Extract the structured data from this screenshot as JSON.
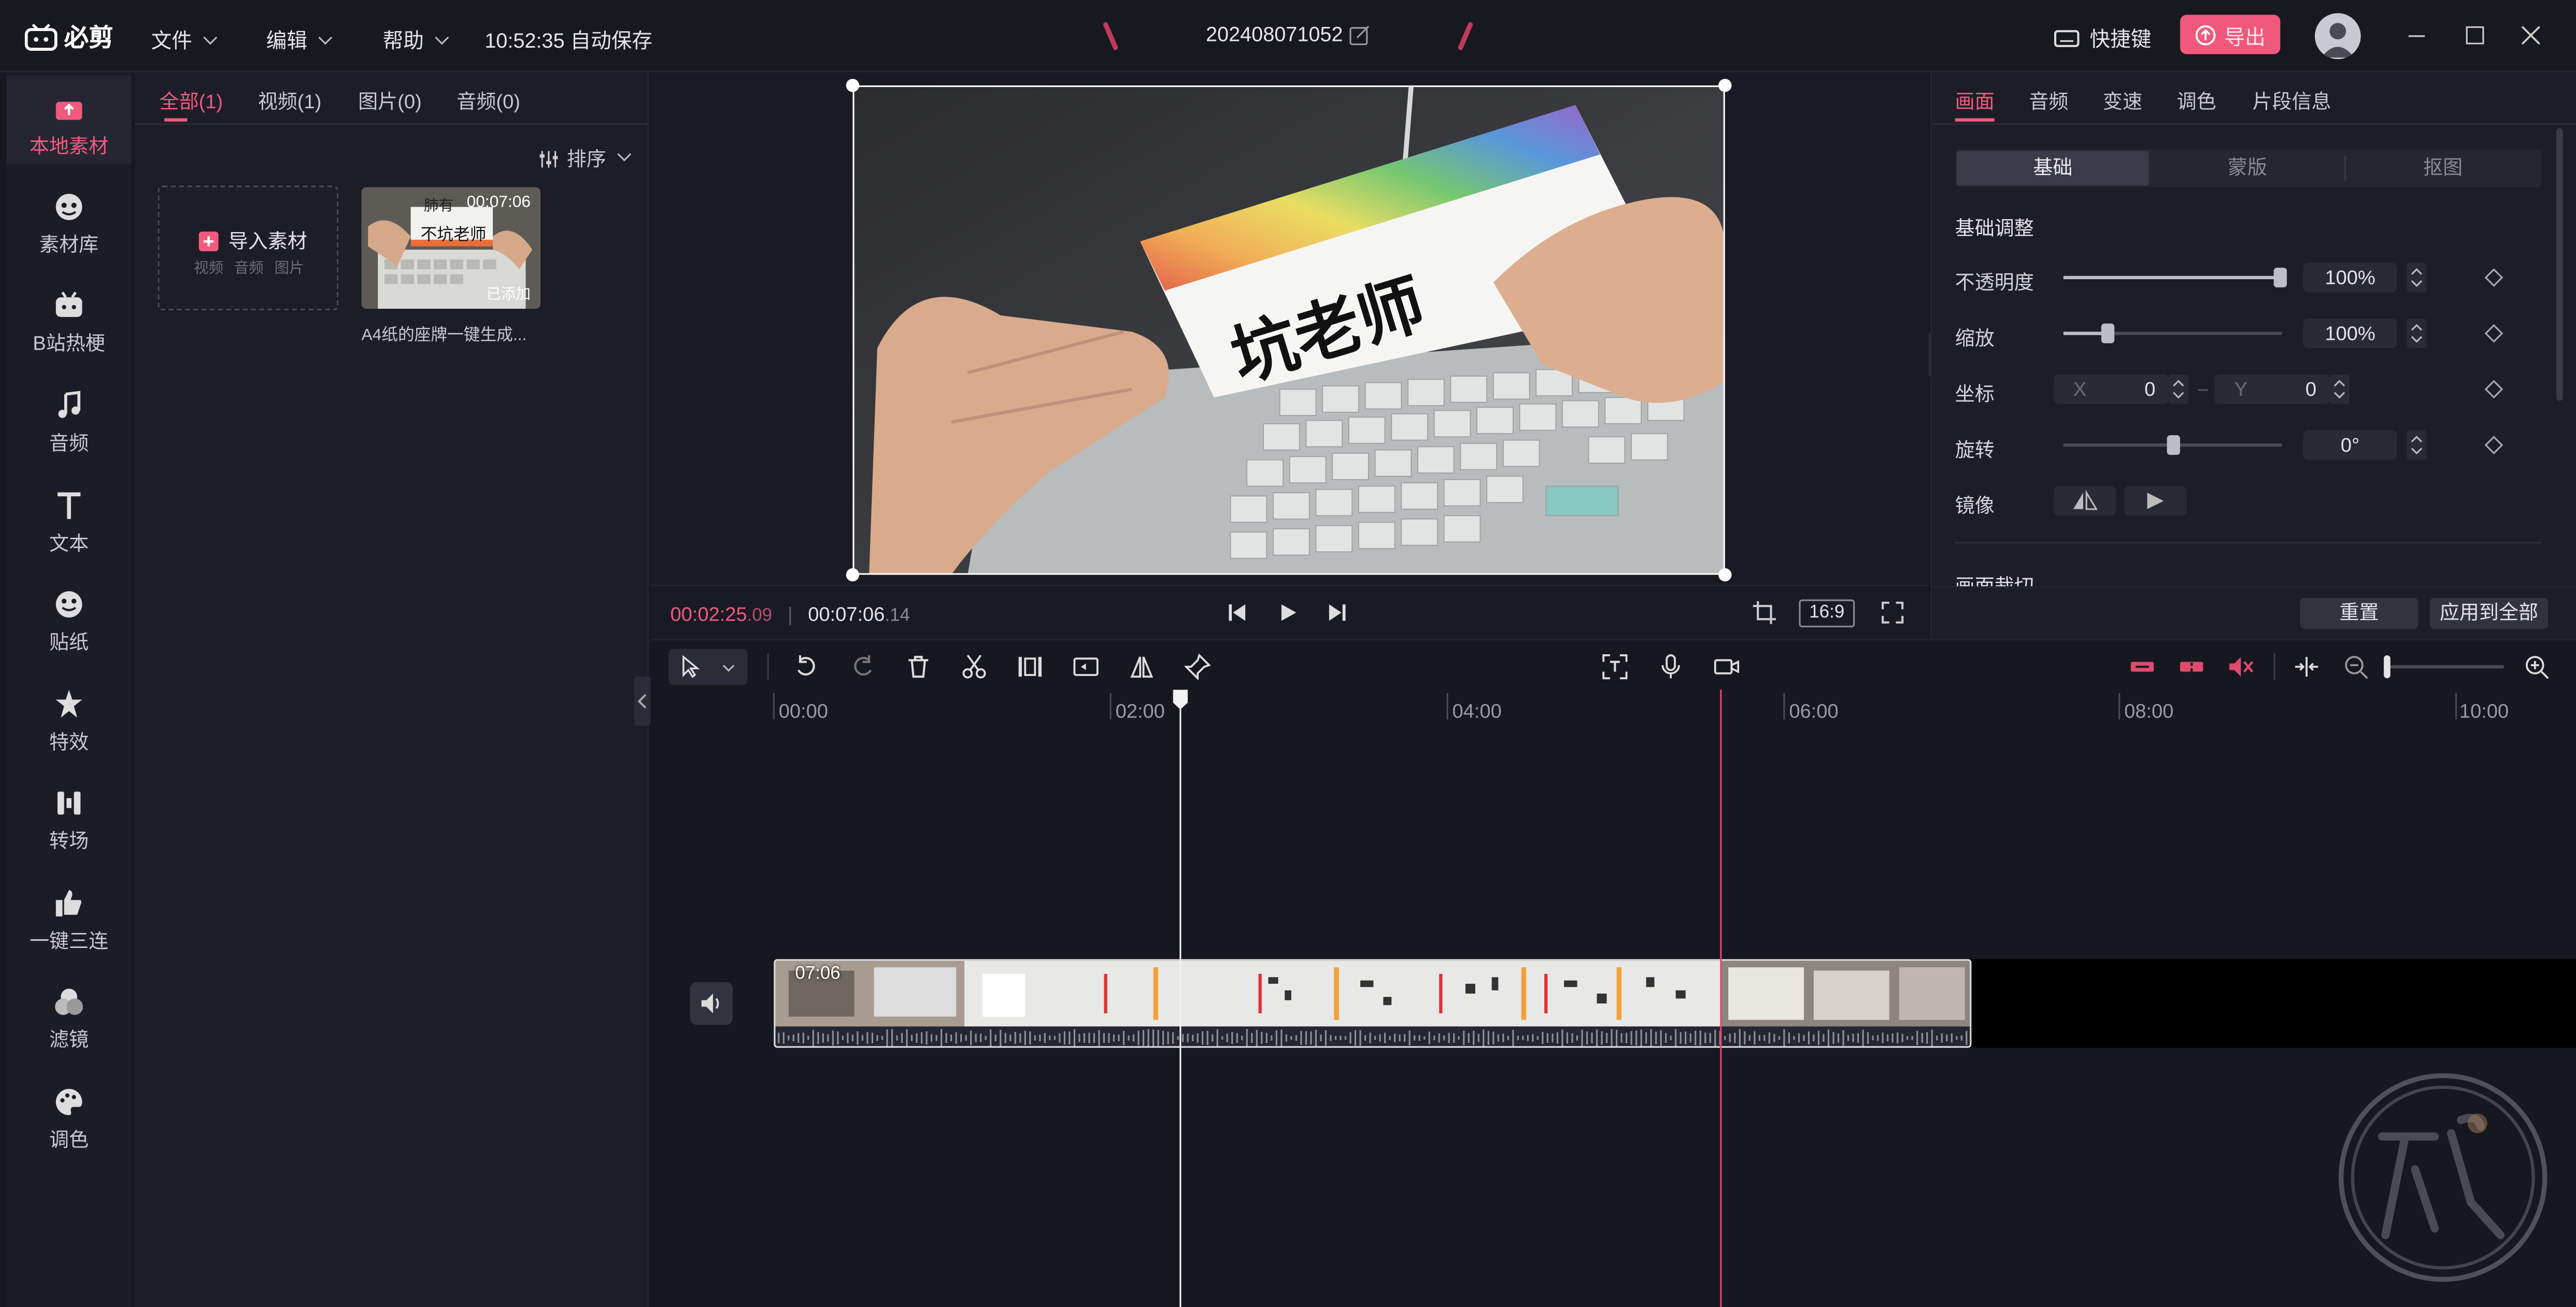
{
  "app": {
    "logo_text": "必剪",
    "project_name": "202408071052",
    "save_status": "10:52:35 自动保存"
  },
  "menu": {
    "file": "文件",
    "edit": "编辑",
    "help": "帮助"
  },
  "header_right": {
    "shortcuts": "快捷键",
    "export": "导出"
  },
  "left_nav": [
    {
      "label": "本地素材",
      "icon": "local-media-icon",
      "active": true
    },
    {
      "label": "素材库",
      "icon": "library-icon"
    },
    {
      "label": "B站热梗",
      "icon": "bilibili-icon"
    },
    {
      "label": "音频",
      "icon": "music-note-icon"
    },
    {
      "label": "文本",
      "icon": "text-icon"
    },
    {
      "label": "贴纸",
      "icon": "sticker-icon"
    },
    {
      "label": "特效",
      "icon": "effects-icon"
    },
    {
      "label": "转场",
      "icon": "transition-icon"
    },
    {
      "label": "一键三连",
      "icon": "thumbs-up-icon"
    },
    {
      "label": "滤镜",
      "icon": "filter-icon"
    },
    {
      "label": "调色",
      "icon": "palette-icon"
    }
  ],
  "media_panel": {
    "tabs": [
      "全部(1)",
      "视频(1)",
      "图片(0)",
      "音频(0)"
    ],
    "sort_label": "排序",
    "import": {
      "label": "导入素材",
      "sub": "视频 音频 图片"
    },
    "clip": {
      "duration": "00:07:06",
      "badge": "已添加",
      "name": "A4纸的座牌一键生成...",
      "thumb_text": "不坑老师",
      "thumb_overlay_text": "肺有"
    }
  },
  "preview": {
    "current_time_main": "00:02:25",
    "current_time_frac": ".09",
    "total_time_main": "00:07:06",
    "total_time_frac": ".14",
    "aspect_ratio": "16:9"
  },
  "props_panel": {
    "tabs": [
      "画面",
      "音频",
      "变速",
      "调色",
      "片段信息"
    ],
    "subtabs": [
      "基础",
      "蒙版",
      "抠图"
    ],
    "section_title": "基础调整",
    "opacity": {
      "label": "不透明度",
      "value": "100%",
      "level": 1.0
    },
    "scale": {
      "label": "缩放",
      "value": "100%",
      "level": 0.2
    },
    "position": {
      "label": "坐标",
      "x_label": "X",
      "x": "0",
      "y_label": "Y",
      "y": "0"
    },
    "rotation": {
      "label": "旋转",
      "value": "0°",
      "level": 0.5
    },
    "mirror": {
      "label": "镜像"
    },
    "next_section": "画面裁切",
    "reset_button": "重置",
    "apply_all_button": "应用到全部"
  },
  "timeline": {
    "ticks": [
      "00:00",
      "02:00",
      "04:00",
      "06:00",
      "08:00",
      "10:00"
    ],
    "clip_duration_label": "07:06"
  }
}
